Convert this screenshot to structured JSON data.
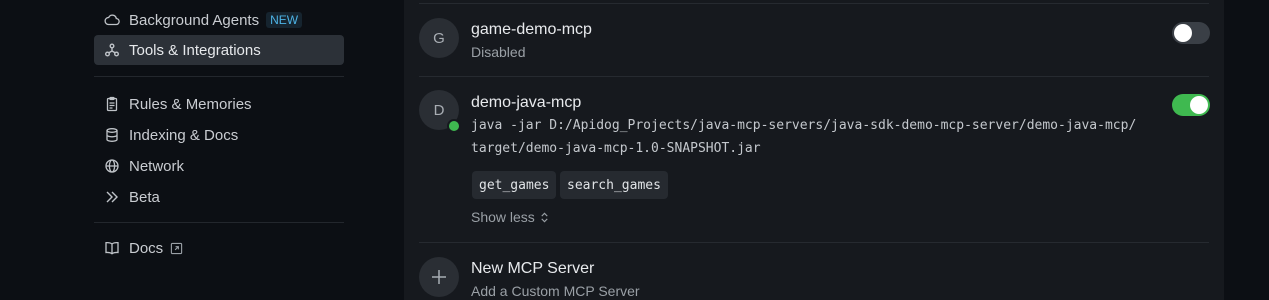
{
  "sidebar": {
    "items": [
      {
        "label": "Background Agents",
        "icon": "cloud-icon",
        "badge": "NEW"
      },
      {
        "label": "Tools & Integrations",
        "icon": "integrations-icon",
        "active": true
      },
      {
        "label": "Rules & Memories",
        "icon": "clipboard-icon"
      },
      {
        "label": "Indexing & Docs",
        "icon": "database-icon"
      },
      {
        "label": "Network",
        "icon": "globe-icon"
      },
      {
        "label": "Beta",
        "icon": "double-chevron-icon"
      },
      {
        "label": "Docs",
        "icon": "book-icon",
        "external": true
      }
    ]
  },
  "servers": [
    {
      "initial": "G",
      "name": "game-demo-mcp",
      "status": "Disabled",
      "enabled": false
    },
    {
      "initial": "D",
      "name": "demo-java-mcp",
      "enabled": true,
      "command_line1": "java -jar D:/Apidog_Projects/java-mcp-servers/java-sdk-demo-mcp-server/demo-java-mcp/",
      "command_line2": "target/demo-java-mcp-1.0-SNAPSHOT.jar",
      "tools": [
        "get_games",
        "search_games"
      ],
      "toggle_details": "Show less"
    }
  ],
  "add_server": {
    "title": "New MCP Server",
    "subtitle": "Add a Custom MCP Server"
  },
  "colors": {
    "accent_green": "#3fb950",
    "badge_blue": "#4db3e6",
    "active_bg": "#2c3138"
  }
}
